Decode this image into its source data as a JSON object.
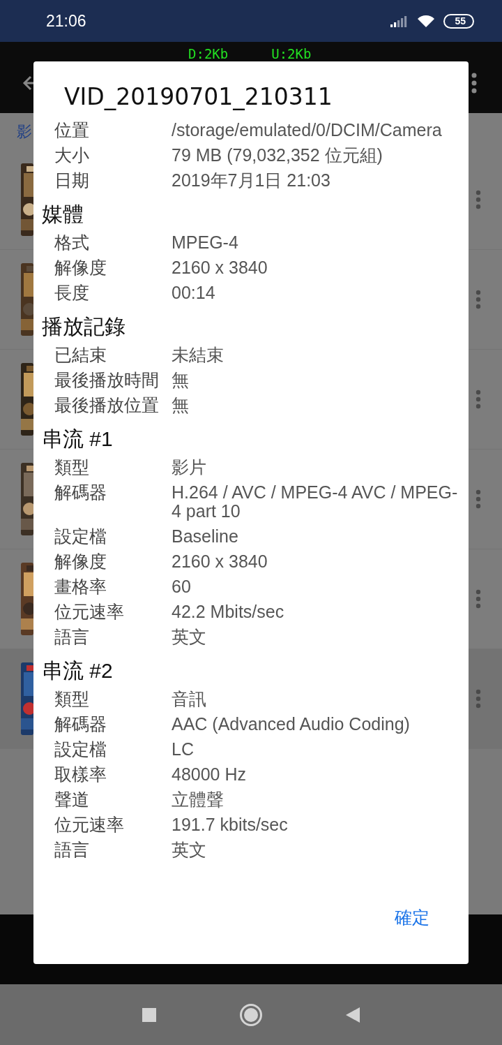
{
  "status_bar": {
    "time": "21:06",
    "battery": "55"
  },
  "net_speed": {
    "down": "D:2Kb",
    "up": "U:2Kb"
  },
  "background": {
    "tab_label": "影"
  },
  "dialog": {
    "title": "VID_20190701_210311",
    "sections": [
      {
        "rows": [
          {
            "label": "位置",
            "value": "/storage/emulated/0/DCIM/Camera",
            "kind": "path"
          },
          {
            "label": "大小",
            "value": "79 MB (79,032,352 位元組)"
          },
          {
            "label": "日期",
            "value": "2019年7月1日 21:03"
          }
        ]
      },
      {
        "heading": "媒體",
        "rows": [
          {
            "label": "格式",
            "value": "MPEG-4"
          },
          {
            "label": "解像度",
            "value": "2160 x 3840"
          },
          {
            "label": "長度",
            "value": "00:14"
          }
        ]
      },
      {
        "heading": "播放記錄",
        "rows": [
          {
            "label": "已結束",
            "value": "未結束"
          },
          {
            "label": "最後播放時間",
            "value": "無"
          },
          {
            "label": "最後播放位置",
            "value": "無"
          }
        ]
      },
      {
        "heading": "串流 #1",
        "rows": [
          {
            "label": "類型",
            "value": "影片"
          },
          {
            "label": "解碼器",
            "value": "H.264 / AVC / MPEG-4 AVC / MPEG-4 part 10"
          },
          {
            "label": "設定檔",
            "value": "Baseline"
          },
          {
            "label": "解像度",
            "value": "2160 x 3840"
          },
          {
            "label": "畫格率",
            "value": "60"
          },
          {
            "label": "位元速率",
            "value": "42.2 Mbits/sec"
          },
          {
            "label": "語言",
            "value": "英文"
          }
        ]
      },
      {
        "heading": "串流 #2",
        "rows": [
          {
            "label": "類型",
            "value": "音訊"
          },
          {
            "label": "解碼器",
            "value": "AAC (Advanced Audio Coding)"
          },
          {
            "label": "設定檔",
            "value": "LC"
          },
          {
            "label": "取樣率",
            "value": "48000 Hz"
          },
          {
            "label": "聲道",
            "value": "立體聲"
          },
          {
            "label": "位元速率",
            "value": "191.7 kbits/sec"
          },
          {
            "label": "語言",
            "value": "英文"
          }
        ]
      }
    ],
    "ok_button": "確定"
  }
}
